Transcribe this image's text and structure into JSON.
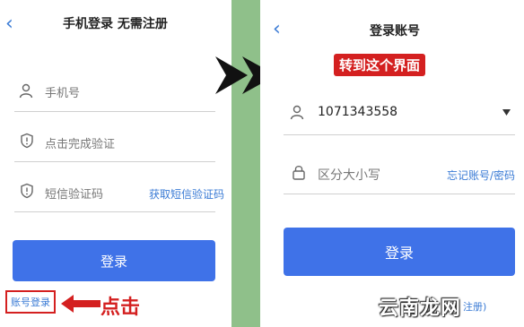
{
  "left": {
    "back_glyph": "‹",
    "title": "手机登录 无需注册",
    "phone_placeholder": "手机号",
    "verify_text": "点击完成验证",
    "sms_placeholder": "短信验证码",
    "get_sms_link": "获取短信验证码",
    "login_button": "登录",
    "account_login_link": "账号登录",
    "callout": "点击"
  },
  "right": {
    "back_glyph": "‹",
    "title": "登录账号",
    "callout": "转到这个界面",
    "account_value": "1071343558",
    "password_placeholder": "区分大小写",
    "forgot_link": "忘记账号/密码",
    "login_button": "登录"
  },
  "watermark": {
    "text": "云南龙网",
    "trailing": "注册)"
  },
  "colors": {
    "primary": "#3f72e8",
    "link": "#3a7bd5",
    "callout_red": "#d42020",
    "divider_green": "#8fc08a"
  }
}
